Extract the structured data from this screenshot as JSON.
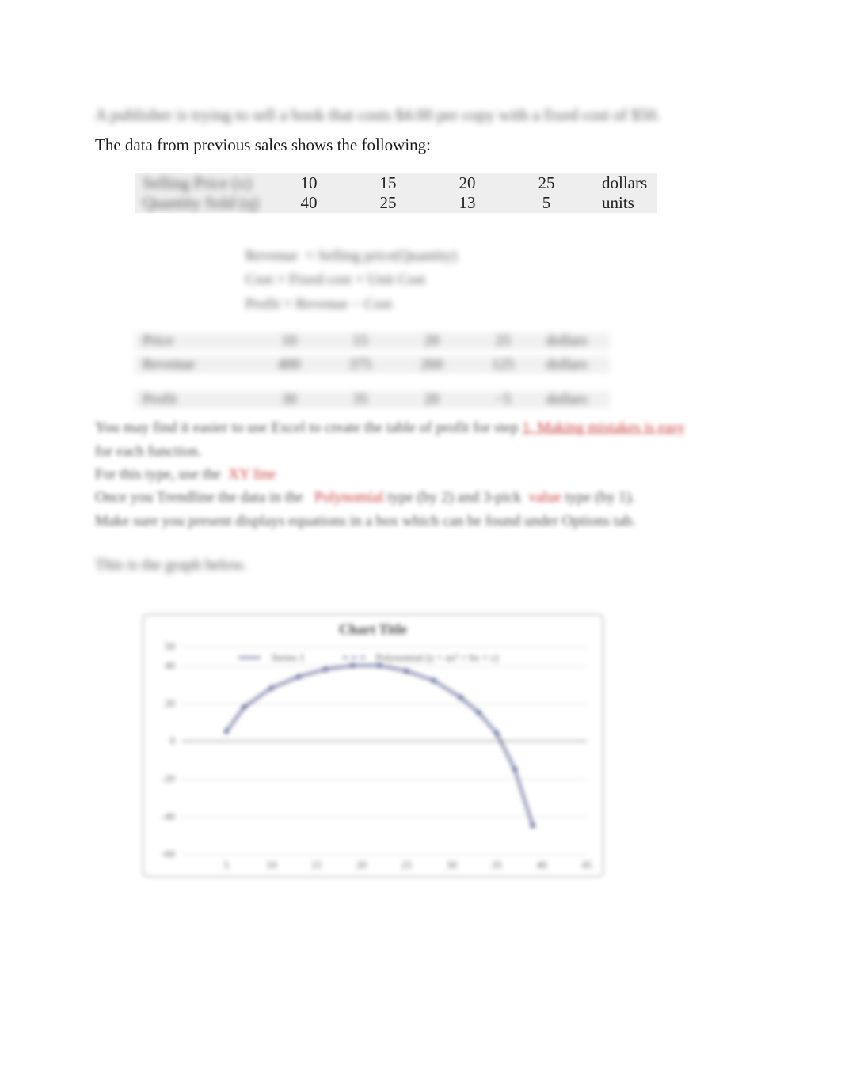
{
  "intro_blurred": "A publisher is trying to sell a book that costs $4.00 per copy with a fixed cost of $50.",
  "intro_crisp": "The data from previous sales shows the following:",
  "table1": {
    "row_labels": [
      "Selling Price (x)",
      "Quantity Sold (q)"
    ],
    "cols": [
      "10",
      "15",
      "20",
      "25"
    ],
    "rows": [
      [
        "40",
        "25",
        "13",
        "5"
      ]
    ],
    "units": [
      "dollars",
      "units"
    ]
  },
  "defs": {
    "line1a": "Revenue",
    "line1b": "= Selling price(Quantity)",
    "line2a": "Cost",
    "line2b": "= Fixed cost + Unit Cost",
    "line3a": "Profit",
    "line3b": "= Revenue − Cost"
  },
  "table2": {
    "label": "Price",
    "vals": [
      "10",
      "15",
      "20",
      "25"
    ],
    "unit": "dollars"
  },
  "table3": {
    "label": "Revenue",
    "vals": [
      "400",
      "375",
      "260",
      "125"
    ],
    "unit": "dollars"
  },
  "table4": {
    "label": "Profit",
    "vals": [
      "30",
      "35",
      "20",
      "−5"
    ],
    "unit": "dollars"
  },
  "para": {
    "p1a": "You may find it easier to use Excel to create the",
    "p1b": "table of profit for step",
    "p1c": "1. Making mistakes is easy",
    "p2": "for each function.",
    "p3a": "For this type, use the",
    "p3b": "XY line",
    "p4a": "Once you Trendline the data in the",
    "p4b": "Polynomial",
    "p4c": "type (by 2) and 3‑pick",
    "p4d": "value",
    "p4e": "type (by 1).",
    "p5": "Make sure you present displays equations in a box which can be found under Options tab."
  },
  "prompt": "This is the graph below.",
  "chart_data": {
    "type": "line",
    "title": "Chart Title",
    "xlabel": "",
    "ylabel": "",
    "xlim": [
      0,
      45
    ],
    "ylim": [
      -60,
      50
    ],
    "xticks": [
      5,
      10,
      15,
      20,
      25,
      30,
      35,
      40,
      45
    ],
    "yticks": [
      -60,
      -40,
      -20,
      0,
      20,
      40,
      50
    ],
    "series": [
      {
        "name": "Series 1",
        "x": [
          5,
          7,
          10,
          13,
          16,
          19,
          22,
          25,
          28,
          31,
          33,
          35,
          37,
          39
        ],
        "y": [
          5,
          18,
          28,
          34,
          38,
          40,
          40,
          37,
          32,
          23,
          15,
          4,
          -15,
          -45
        ]
      }
    ],
    "legend": [
      "Series 1",
      "Polynomial (y = ax² + bx + c)"
    ],
    "annotations": []
  }
}
